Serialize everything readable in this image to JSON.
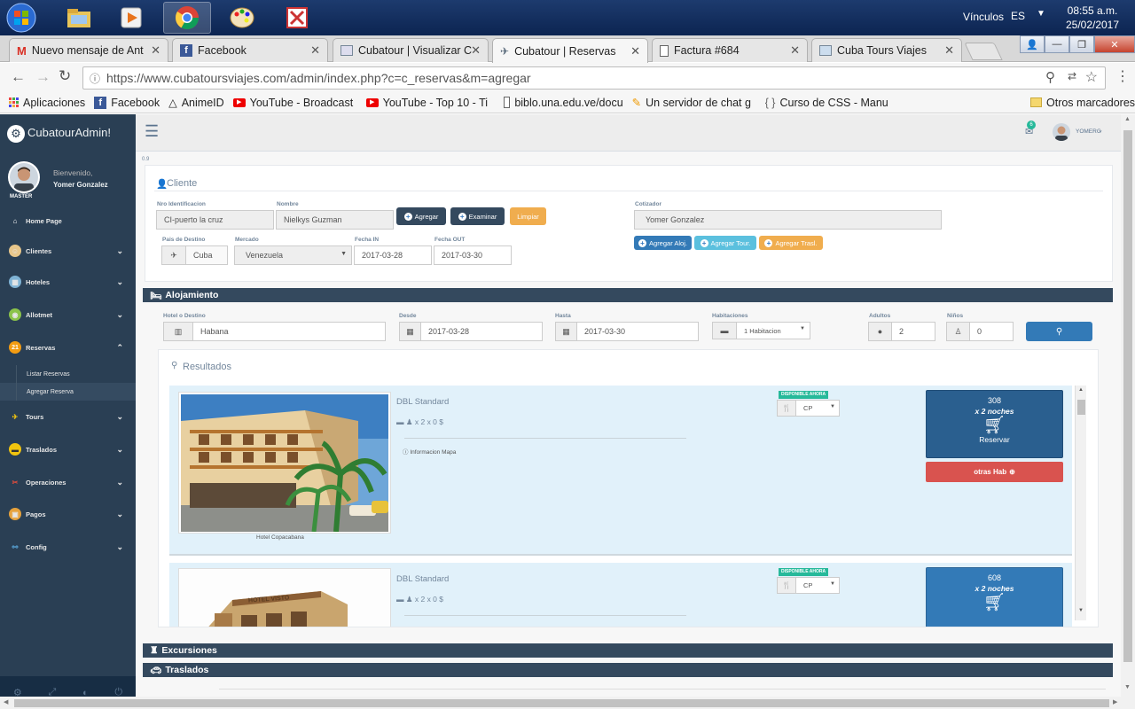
{
  "taskbar": {
    "vinculos": "Vínculos",
    "lang": "ES",
    "time": "08:55 a.m.",
    "date": "25/02/2017"
  },
  "tabs": [
    {
      "label": "Nuevo mensaje de Ant",
      "icon": "gmail-icon"
    },
    {
      "label": "Facebook",
      "icon": "facebook-icon"
    },
    {
      "label": "Cubatour | Visualizar C",
      "icon": "cubatour-icon"
    },
    {
      "label": "Cubatour | Reservas",
      "icon": "cubatour-icon"
    },
    {
      "label": "Factura #684",
      "icon": "page-icon"
    },
    {
      "label": "Cuba Tours Viajes",
      "icon": "site-icon"
    }
  ],
  "address": {
    "url": "https://www.cubatoursviajes.com/admin/index.php?c=c_reservas&m=agregar"
  },
  "bookmarks": [
    {
      "label": "Aplicaciones"
    },
    {
      "label": "Facebook"
    },
    {
      "label": "AnimeID"
    },
    {
      "label": "YouTube - Broadcast"
    },
    {
      "label": "YouTube - Top 10 - Ti"
    },
    {
      "label": "biblo.una.edu.ve/docu"
    },
    {
      "label": "Un servidor de chat g"
    },
    {
      "label": "Curso de CSS - Manu"
    },
    {
      "label": "Otros marcadores"
    }
  ],
  "sidebar": {
    "brand": "CubatourAdmin!",
    "welcome": "Bienvenido,",
    "user": "Yomer Gonzalez",
    "role": "MASTER",
    "items": [
      {
        "label": "Home Page"
      },
      {
        "label": "Clientes"
      },
      {
        "label": "Hoteles"
      },
      {
        "label": "Allotmet"
      },
      {
        "label": "Reservas"
      },
      {
        "label": "Tours"
      },
      {
        "label": "Traslados"
      },
      {
        "label": "Operaciones"
      },
      {
        "label": "Pagos"
      },
      {
        "label": "Config"
      }
    ],
    "subitems": [
      {
        "label": "Listar Reservas"
      },
      {
        "label": "Agregar Reserva"
      }
    ],
    "reservas_badge": "21"
  },
  "topnav": {
    "user": "YOMERG",
    "mail_badge": "6"
  },
  "version": "0.9",
  "cliente": {
    "title": "Cliente",
    "nro_label": "Nro Identificacion",
    "nro_value": "CI-puerto la cruz",
    "nombre_label": "Nombre",
    "nombre_value": "Nielkys Guzman",
    "btn_agregar": "Agregar",
    "btn_examinar": "Examinar",
    "btn_limpiar": "Limpiar",
    "cotizador_label": "Cotizador",
    "cotizador_value": "Yomer Gonzalez",
    "pais_label": "Pais de Destino",
    "pais_value": "Cuba",
    "mercado_label": "Mercado",
    "mercado_value": "Venezuela",
    "fecha_in_label": "Fecha IN",
    "fecha_in_value": "2017-03-28",
    "fecha_out_label": "Fecha OUT",
    "fecha_out_value": "2017-03-30",
    "btn_agregar_aloj": "Agregar Aloj.",
    "btn_agregar_tour": "Agregar Tour.",
    "btn_agregar_tras": "Agregar Trasl."
  },
  "alojamiento": {
    "title": "Alojamiento",
    "hotel_label": "Hotel o Destino",
    "hotel_value": "Habana",
    "desde_label": "Desde",
    "desde_value": "2017-03-28",
    "hasta_label": "Hasta",
    "hasta_value": "2017-03-30",
    "hab_label": "Habitaciones",
    "hab_value": "1 Habitacion",
    "adultos_label": "Adultos",
    "adultos_value": "2",
    "ninos_label": "Niños",
    "ninos_value": "0",
    "resultados": "Resultados"
  },
  "results": [
    {
      "room": "DBL Standard",
      "occupancy": "x 2  x 0 $",
      "links": "Informacion  Mapa",
      "badge": "DISPONIBLE AHORA",
      "plan": "CP",
      "price": "308",
      "nights": "x 2 noches",
      "reservar": "Reservar",
      "otras": "otras Hab",
      "hotel_caption": "Hotel Copacabana"
    },
    {
      "room": "DBL Standard",
      "occupancy": "x 2  x 0 $",
      "badge": "DISPONIBLE AHORA",
      "plan": "CP",
      "price": "608",
      "nights": "x 2 noches",
      "hotel_sign": "HOTEL VISTO"
    }
  ],
  "excursiones": {
    "title": "Excursiones"
  },
  "traslados": {
    "title": "Traslados"
  },
  "colors": {
    "sidebar": "#2a3f54",
    "section": "#34495e",
    "primary": "#337ab7",
    "dark_btn": "#2a5f8f",
    "info": "#5bc0de",
    "warning": "#f0ad4e",
    "danger": "#d9534f",
    "success": "#26b99a",
    "result_bg": "#e1f1fa"
  }
}
